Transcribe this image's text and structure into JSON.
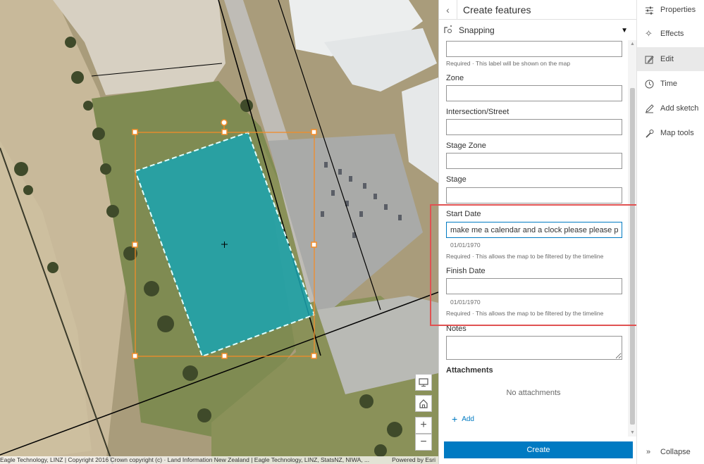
{
  "panel": {
    "title": "Create features",
    "back_icon": "chevron-left-icon",
    "snapping_label": "Snapping",
    "fields": [
      {
        "label": "",
        "value": "",
        "hint": "Required · This label will be shown on the map"
      },
      {
        "label": "Zone",
        "value": ""
      },
      {
        "label": "Intersection/Street",
        "value": ""
      },
      {
        "label": "Stage Zone",
        "value": ""
      },
      {
        "label": "Stage",
        "value": ""
      },
      {
        "label": "Start Date",
        "value": "make me a calendar and a clock please please plea",
        "date": "01/01/1970",
        "hint": "Required · This allows the map to be filtered by the timeline"
      },
      {
        "label": "Finish Date",
        "value": "",
        "date": "01/01/1970",
        "hint": "Required · This allows the map to be filtered by the timeline"
      },
      {
        "label": "Notes",
        "value": ""
      }
    ],
    "attachments_title": "Attachments",
    "no_attachments": "No attachments",
    "add_label": "Add",
    "create_label": "Create"
  },
  "toolbar": {
    "items": [
      {
        "label": "Properties",
        "icon": "sliders-icon"
      },
      {
        "label": "Effects",
        "icon": "sparkle-icon"
      },
      {
        "label": "Edit",
        "icon": "pencil-square-icon",
        "active": true
      },
      {
        "label": "Time",
        "icon": "clock-icon"
      },
      {
        "label": "Add sketch",
        "icon": "pen-icon"
      },
      {
        "label": "Map tools",
        "icon": "wrench-icon"
      }
    ],
    "collapse_label": "Collapse"
  },
  "map": {
    "attribution": "Eagle Technology, LINZ | Copyright 2016 Crown copyright (c) · Land Information New Zealand | Eagle Technology, LINZ, StatsNZ, NIWA, ...",
    "powered_by": "Powered by Esri",
    "controls": [
      "screen-icon",
      "home-icon",
      "zoom-in-icon",
      "zoom-out-icon"
    ]
  },
  "colors": {
    "accent": "#007ac2",
    "polygon_fill": "#1aa3b0",
    "selection": "#f28c28",
    "highlight": "#e05252"
  }
}
